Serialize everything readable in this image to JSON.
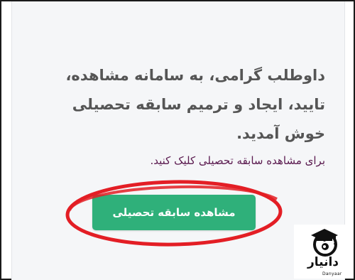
{
  "content": {
    "welcome_text": "داوطلب گرامی، به سامانه مشاهده، تایید، ایجاد و ترمیم سابقه تحصیلی خوش آمدید.",
    "instruction_text": "برای مشاهده سابقه تحصیلی کلیک کنید.",
    "view_button_label": "مشاهده سابقه تحصیلی"
  },
  "watermark": {
    "brand": "دانیار",
    "brand_latin": "Danyaar",
    "icon": "graduation-cap-icon"
  },
  "colors": {
    "button": "#2fb07a",
    "highlight": "#e31e25",
    "text": "#555555",
    "instruction": "#5a1a4f"
  }
}
